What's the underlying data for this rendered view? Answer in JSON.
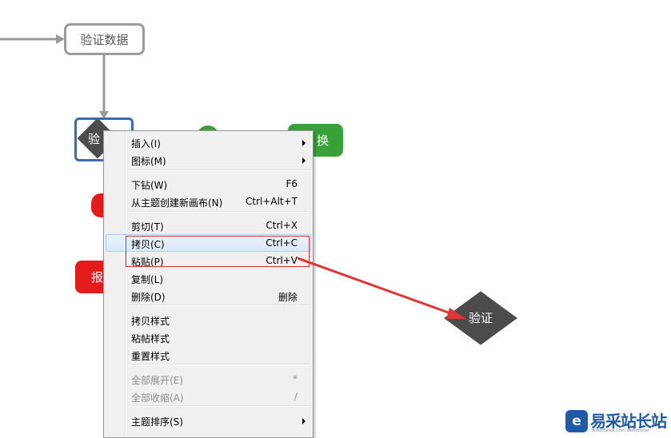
{
  "canvas": {
    "topics": {
      "verify_data": "验证数据",
      "selected_partial": "验",
      "green_partial": "换",
      "red_partial": "报",
      "verify_diamond": "验证"
    }
  },
  "context_menu": {
    "items": [
      {
        "label": "插入(I)",
        "shortcut": "",
        "submenu": true,
        "disabled": false
      },
      {
        "label": "图标(M)",
        "shortcut": "",
        "submenu": true,
        "disabled": false
      },
      {
        "label": "下钻(W)",
        "shortcut": "F6",
        "submenu": false,
        "disabled": false
      },
      {
        "label": "从主题创建新画布(N)",
        "shortcut": "Ctrl+Alt+T",
        "submenu": false,
        "disabled": false
      },
      {
        "label": "剪切(T)",
        "shortcut": "Ctrl+X",
        "submenu": false,
        "disabled": false
      },
      {
        "label": "拷贝(C)",
        "shortcut": "Ctrl+C",
        "submenu": false,
        "disabled": false,
        "hover": true
      },
      {
        "label": "粘贴(P)",
        "shortcut": "Ctrl+V",
        "submenu": false,
        "disabled": false
      },
      {
        "label": "复制(L)",
        "shortcut": "",
        "submenu": false,
        "disabled": false
      },
      {
        "label": "删除(D)",
        "shortcut": "删除",
        "submenu": false,
        "disabled": false
      },
      {
        "label": "拷贝样式",
        "shortcut": "",
        "submenu": false,
        "disabled": false
      },
      {
        "label": "粘帖样式",
        "shortcut": "",
        "submenu": false,
        "disabled": false
      },
      {
        "label": "重置样式",
        "shortcut": "",
        "submenu": false,
        "disabled": false
      },
      {
        "label": "全部展开(E)",
        "shortcut": "*",
        "submenu": false,
        "disabled": true
      },
      {
        "label": "全部收缩(A)",
        "shortcut": "/",
        "submenu": false,
        "disabled": true
      },
      {
        "label": "主题排序(S)",
        "shortcut": "",
        "submenu": true,
        "disabled": false
      }
    ]
  },
  "annotation": {
    "highlight_color": "#d83030",
    "arrow_color": "#e03535"
  },
  "colors": {
    "selection_border": "#3d69b0",
    "green_topic": "#3aa13a",
    "red_topic": "#e31b1b",
    "diamond": "#4c4c4c"
  },
  "watermark": {
    "logo_icon": "e-logo-icon",
    "text": "易采站长站",
    "subtext": "Www.Easck.Com Webmaster"
  }
}
